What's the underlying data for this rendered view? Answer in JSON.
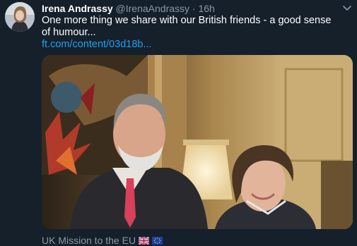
{
  "tweet": {
    "author_name": "Irena Andrassy",
    "handle": "@IrenaAndrassy",
    "separator": "·",
    "time": "16h",
    "text": "One more thing we share with our British friends - a good sense of humour...",
    "link_text": "ft.com/content/03d18b...",
    "media_source": "UK Mission to the EU",
    "source_flags": [
      "uk-flag-icon",
      "eu-flag-icon"
    ]
  },
  "colors": {
    "background": "#15202b",
    "text": "#ffffff",
    "secondary_text": "#8899a6",
    "link": "#1da1f2"
  },
  "icons": {
    "menu": "chevron-down-icon",
    "avatar": "avatar"
  }
}
